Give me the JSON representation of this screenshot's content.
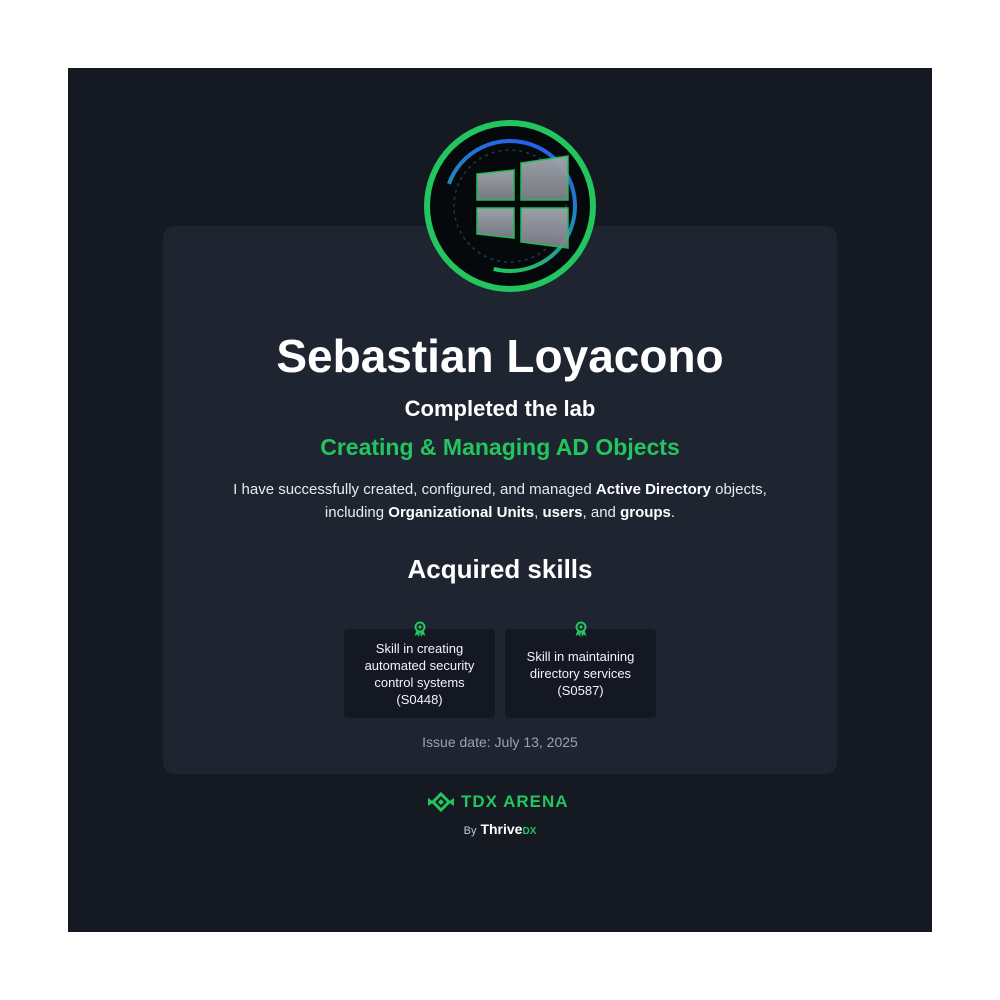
{
  "certificate": {
    "name": "Sebastian Loyacono",
    "completed_text": "Completed the lab",
    "lab_title": "Creating & Managing AD Objects",
    "description": {
      "part1": "I have successfully created, configured, and managed ",
      "bold1": "Active Directory",
      "part2": " objects, including ",
      "bold2": "Organizational Units",
      "part3": ", ",
      "bold3": "users",
      "part4": ", and ",
      "bold4": "groups",
      "part5": "."
    },
    "skills_heading": "Acquired skills",
    "skills": [
      {
        "label": "Skill in creating automated security control systems (S0448)",
        "icon": "award-ribbon-icon"
      },
      {
        "label": "Skill in maintaining directory services (S0587)",
        "icon": "award-ribbon-icon"
      }
    ],
    "issue_date": "Issue date: July 13, 2025",
    "badge_icon": "windows-logo-badge"
  },
  "brand": {
    "name": "TDX ARENA",
    "by": "By",
    "company": "Thrive",
    "company_suffix": "DX",
    "mark_icon": "tdx-arena-logo-icon"
  },
  "colors": {
    "background": "#151922",
    "card": "#1e2430",
    "skill_card": "#131822",
    "accent_green": "#22c55e",
    "accent_blue": "#2563eb",
    "page": "#ffffff"
  }
}
